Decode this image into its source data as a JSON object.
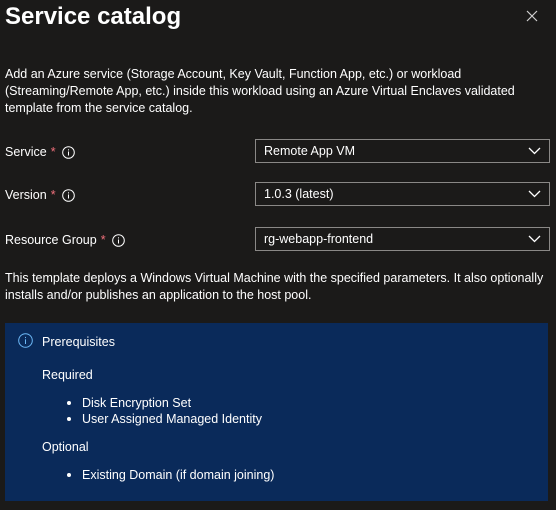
{
  "panel": {
    "title": "Service catalog",
    "description": "Add an Azure service (Storage Account, Key Vault, Function App, etc.) or workload (Streaming/Remote App, etc.) inside this workload using an Azure Virtual Enclaves validated template from the service catalog.",
    "close_icon": "close-icon"
  },
  "fields": {
    "service": {
      "label": "Service",
      "required_mark": "*",
      "value": "Remote App VM"
    },
    "version": {
      "label": "Version",
      "required_mark": "*",
      "value": "1.0.3 (latest)"
    },
    "resource_group": {
      "label": "Resource Group",
      "required_mark": "*",
      "value": "rg-webapp-frontend"
    }
  },
  "template_note": "This template deploys a Windows Virtual Machine with the specified parameters. It also optionally installs and/or publishes an application to the host pool.",
  "prerequisites": {
    "heading": "Prerequisites",
    "required_label": "Required",
    "required_items": [
      "Disk Encryption Set",
      "User Assigned Managed Identity"
    ],
    "optional_label": "Optional",
    "optional_items": [
      "Existing Domain (if domain joining)"
    ]
  },
  "colors": {
    "background": "#1b1a19",
    "info_box": "#0a2a5a",
    "required_star": "#f1707b",
    "info_icon": "#6cb8f6",
    "input_border": "#8a8886"
  }
}
